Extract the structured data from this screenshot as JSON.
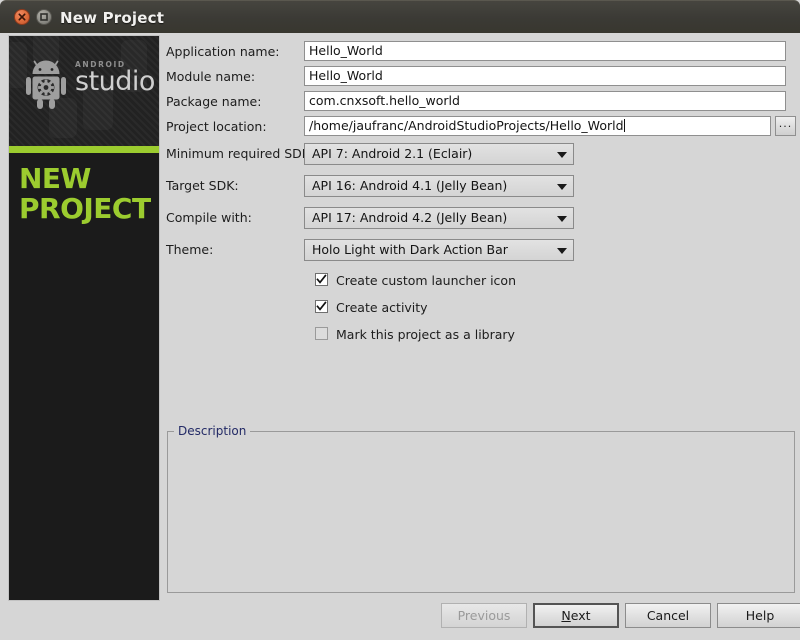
{
  "window": {
    "title": "New Project",
    "close_icon": "close-icon",
    "maximize_icon": "maximize-icon"
  },
  "banner": {
    "brand_small": "ANDROID",
    "brand_large": "studio",
    "heading_line1": "NEW",
    "heading_line2": "PROJECT",
    "accent_color": "#9ccc2f",
    "background_color": "#1b1b1b",
    "robot_icon": "android-robot-gear-icon"
  },
  "form": {
    "fields": [
      {
        "label": "Application name:",
        "value": "Hello_World",
        "type": "text"
      },
      {
        "label": "Module name:",
        "value": "Hello_World",
        "type": "text"
      },
      {
        "label": "Package name:",
        "value": "com.cnxsoft.hello_world",
        "type": "text"
      },
      {
        "label": "Project location:",
        "value": "/home/jaufranc/AndroidStudioProjects/Hello_World",
        "type": "text-browse",
        "browse_label": "..."
      },
      {
        "label": "Minimum required SDK:",
        "value": "API 7: Android 2.1 (Eclair)",
        "type": "combo"
      },
      {
        "label": "Target SDK:",
        "value": "API 16: Android 4.1 (Jelly Bean)",
        "type": "combo"
      },
      {
        "label": "Compile with:",
        "value": "API 17: Android 4.2 (Jelly Bean)",
        "type": "combo"
      },
      {
        "label": "Theme:",
        "value": "Holo Light with Dark Action Bar",
        "type": "combo"
      }
    ],
    "checkboxes": [
      {
        "label": "Create custom launcher icon",
        "checked": true
      },
      {
        "label": "Create activity",
        "checked": true
      },
      {
        "label": "Mark this project as a library",
        "checked": false
      }
    ],
    "description_group": {
      "title": "Description",
      "body": ""
    }
  },
  "buttons": {
    "previous": {
      "label": "Previous",
      "disabled": true
    },
    "next": {
      "label": "Next",
      "mnemonic": "N",
      "focused": true
    },
    "cancel": {
      "label": "Cancel"
    },
    "help": {
      "label": "Help"
    }
  }
}
